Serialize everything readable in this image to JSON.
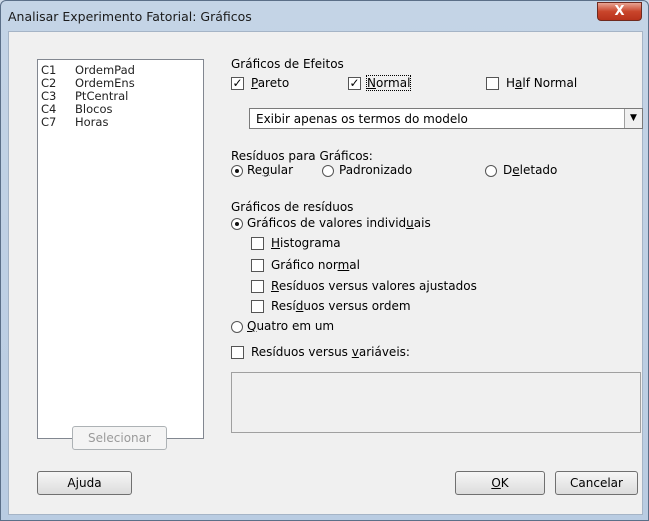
{
  "window": {
    "title": "Analisar Experimento Fatorial: Gráficos",
    "close_glyph": "X"
  },
  "variables": [
    {
      "col": "C1",
      "name": "OrdemPad"
    },
    {
      "col": "C2",
      "name": "OrdemEns"
    },
    {
      "col": "C3",
      "name": "PtCentral"
    },
    {
      "col": "C4",
      "name": "Blocos"
    },
    {
      "col": "C7",
      "name": "Horas"
    }
  ],
  "select_button": "Selecionar",
  "effects": {
    "heading": "Gráficos de Efeitos",
    "pareto": {
      "label_u": "P",
      "label_rest": "areto",
      "checked": true
    },
    "normal": {
      "label_u": "N",
      "label_rest": "ormal",
      "checked": true
    },
    "half_normal": {
      "label_pre": "H",
      "label_u": "a",
      "label_rest": "lf Normal",
      "checked": false
    },
    "combo_value": "Exibir apenas os termos do modelo"
  },
  "residuals_for_plots": {
    "heading": "Resíduos para Gráficos:",
    "regular": {
      "pre": "Re",
      "u": "g",
      "rest": "ular",
      "selected": true
    },
    "padronizado": {
      "label": "Padronizado",
      "selected": false
    },
    "deletado": {
      "pre": "D",
      "u": "e",
      "rest": "letado",
      "selected": false
    }
  },
  "residual_plots": {
    "heading": "Gráficos de resíduos",
    "individual": {
      "pre": "Gráficos de valores individ",
      "u": "u",
      "rest": "ais",
      "selected": true
    },
    "histograma": {
      "u": "H",
      "rest": "istograma",
      "checked": false
    },
    "grafico_normal": {
      "pre": "Gráfico nor",
      "u": "m",
      "rest": "al",
      "checked": false
    },
    "vs_ajustados": {
      "u": "R",
      "rest": "esíduos versus valores ajustados",
      "checked": false
    },
    "vs_ordem": {
      "pre": "Resí",
      "u": "d",
      "rest": "uos versus ordem",
      "checked": false
    },
    "quatro": {
      "u": "Q",
      "rest": "uatro em um",
      "selected": false
    },
    "vs_variaveis": {
      "pre": "Resíduos versus ",
      "u": "v",
      "rest": "ariáveis:",
      "checked": false
    }
  },
  "buttons": {
    "help_pre": "A",
    "help_u": "j",
    "help_rest": "uda",
    "ok_u": "O",
    "ok_rest": "K",
    "cancel": "Cancelar"
  },
  "check_mark": "✓"
}
